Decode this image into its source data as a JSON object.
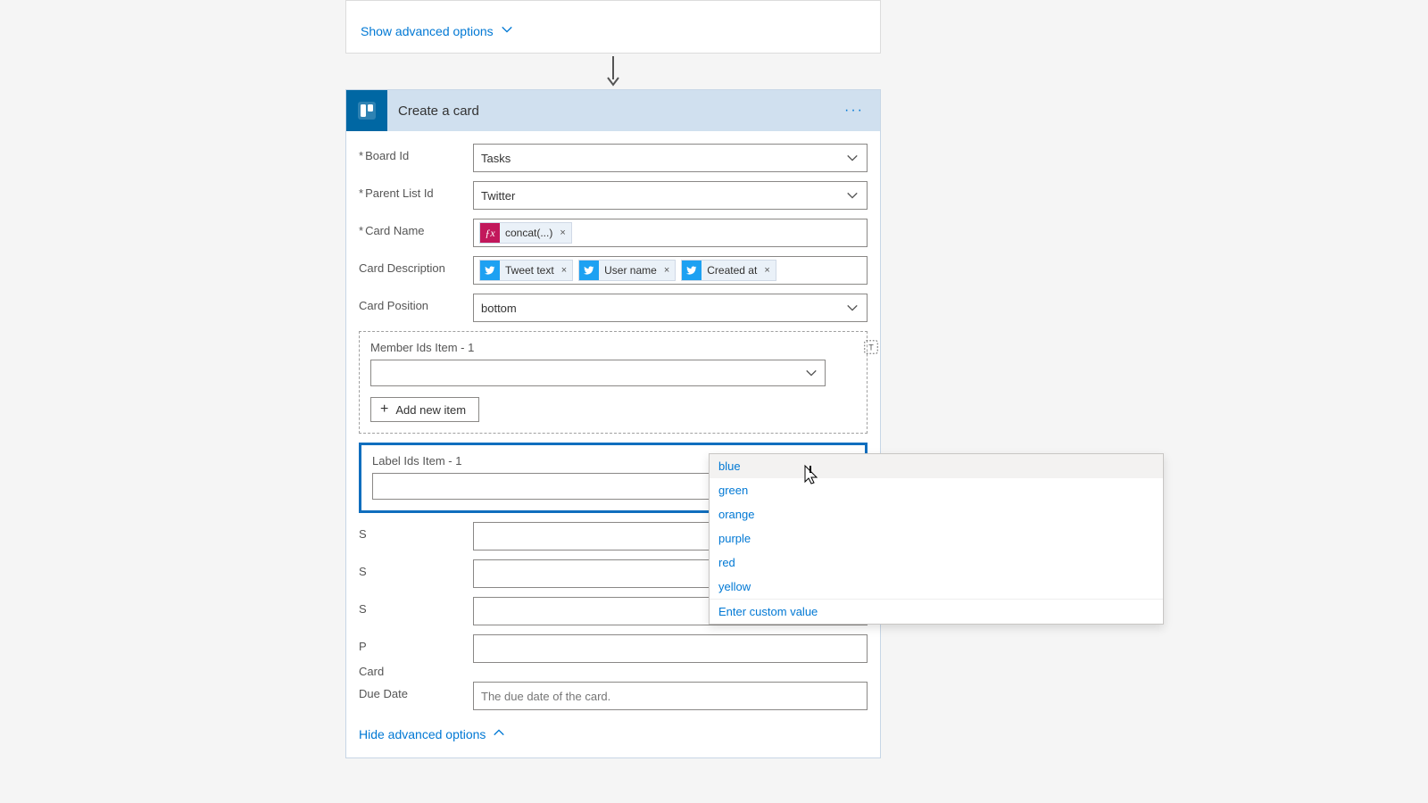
{
  "top": {
    "show_advanced": "Show advanced options"
  },
  "action": {
    "title": "Create a card",
    "fields": {
      "board_id": {
        "label": "Board Id",
        "value": "Tasks"
      },
      "parent_list_id": {
        "label": "Parent List Id",
        "value": "Twitter"
      },
      "card_name": {
        "label": "Card Name",
        "tokens": [
          {
            "type": "fx",
            "text": "concat(...)"
          }
        ]
      },
      "card_description": {
        "label": "Card Description",
        "tokens": [
          {
            "type": "twitter",
            "text": "Tweet text"
          },
          {
            "type": "twitter",
            "text": "User name"
          },
          {
            "type": "twitter",
            "text": "Created at"
          }
        ]
      },
      "card_position": {
        "label": "Card Position",
        "value": "bottom"
      },
      "member_ids": {
        "label": "Member Ids Item - 1",
        "add_label": "Add new item"
      },
      "label_ids": {
        "label": "Label Ids Item - 1",
        "options": [
          "blue",
          "green",
          "orange",
          "purple",
          "red",
          "yellow"
        ],
        "custom_option": "Enter custom value"
      },
      "partial_labels": {
        "s1": "S",
        "s2": "S",
        "s3": "S",
        "p": "P",
        "card_line": "Card"
      },
      "due_date": {
        "label": "Due Date",
        "placeholder": "The due date of the card."
      }
    },
    "hide_advanced": "Hide advanced options"
  }
}
